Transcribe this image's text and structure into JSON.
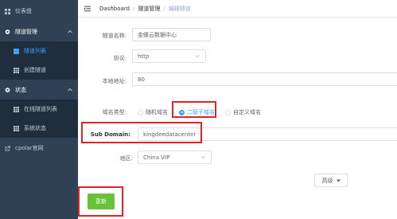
{
  "sidebar": {
    "items": [
      {
        "label": "仪表盘",
        "icon": "dashboard-icon"
      },
      {
        "label": "隧道管理",
        "icon": "gear-icon"
      },
      {
        "label": "隧道列表",
        "icon": "grid-icon",
        "active": true
      },
      {
        "label": "创建隧道",
        "icon": "grid-icon"
      },
      {
        "label": "状态",
        "icon": "gear-icon"
      },
      {
        "label": "在线隧道列表",
        "icon": "grid-icon"
      },
      {
        "label": "系统状态",
        "icon": "grid-icon"
      },
      {
        "label": "cpolar官网",
        "icon": "link-icon"
      }
    ]
  },
  "header": {
    "breadcrumb": [
      "Dashboard",
      "隧道管理",
      "编辑隧道"
    ]
  },
  "form": {
    "tunnel_name_label": "隧道名称:",
    "tunnel_name_value": "金蝶云数据中心",
    "protocol_label": "协议:",
    "protocol_value": "http",
    "local_address_label": "本地地址:",
    "local_address_value": "80",
    "domain_type_label": "域名类型:",
    "domain_type_options": [
      "随机域名",
      "二级子域名",
      "自定义域名"
    ],
    "domain_type_selected": "二级子域名",
    "sub_domain_label": "Sub Domain:",
    "sub_domain_value": "kingdeedatacenter",
    "region_label": "地区:",
    "region_value": "China VIP",
    "advanced_label": "高级",
    "save_label": "更新"
  },
  "colors": {
    "sidebar_bg": "#304156",
    "accent": "#409eff",
    "highlight_red": "#e0242a",
    "save_green": "#67c23a"
  }
}
